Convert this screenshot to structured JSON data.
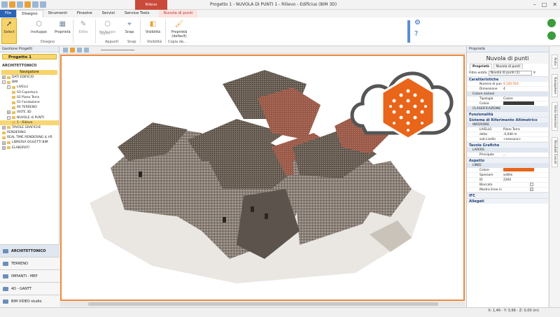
{
  "titlebar": {
    "title": "Progetto 1 - NUVOLA DI PUNTI 1 - Rilievo - Edificius (BIM 3D)",
    "context_header": "Rilievo"
  },
  "tabs": [
    {
      "label": "File"
    },
    {
      "label": "Disegno"
    },
    {
      "label": "Strumenti"
    },
    {
      "label": "Finestre"
    },
    {
      "label": "Servizi"
    },
    {
      "label": "Service Tools"
    },
    {
      "label": "Nuvola di punti"
    }
  ],
  "ribbon": {
    "select": "Select",
    "inviluppo": "Inviluppo",
    "proprieta": "Proprietà",
    "edita": "Edita",
    "inviluppo2": "Inviluppo",
    "taglia": "Taglia",
    "snap": "Snap",
    "visibilita": "Visibilità",
    "proprieta_default": "Proprietà (default)",
    "groups": {
      "disegno": "Disegno",
      "appunti": "Appunti",
      "snap": "Snap",
      "visibilita": "Visibilità",
      "copia": "Copia de..."
    }
  },
  "leftpanel": {
    "header": "Gestione Progetti",
    "project_tab": "Progetto 1",
    "section": "ARCHITETTONICO",
    "navigator": "Navigatore",
    "tree": [
      {
        "label": "DATI EDIFICIO",
        "indent": 0,
        "box": "+"
      },
      {
        "label": "BIM",
        "indent": 0,
        "box": "-"
      },
      {
        "label": "LIVELLI",
        "indent": 1,
        "box": "-"
      },
      {
        "label": "03 Copertura",
        "indent": 2,
        "box": ""
      },
      {
        "label": "02 Piano Terra",
        "indent": 2,
        "box": ""
      },
      {
        "label": "01 Fondazione",
        "indent": 2,
        "box": ""
      },
      {
        "label": "00 TERRENO",
        "indent": 2,
        "box": ""
      },
      {
        "label": "VISTE 3D",
        "indent": 1,
        "box": "+"
      },
      {
        "label": "NUVOLE di PUNTI",
        "indent": 1,
        "box": "-"
      },
      {
        "label": "1 - Rilievo",
        "indent": 2,
        "box": "",
        "selected": true
      },
      {
        "label": "TAVOLE GRAFICHE",
        "indent": 0,
        "box": "+"
      },
      {
        "label": "RENDERING",
        "indent": 0,
        "box": ""
      },
      {
        "label": "REAL TIME RENDERING & VR",
        "indent": 0,
        "box": ""
      },
      {
        "label": "LIBRERIA OGGETTI BIM",
        "indent": 0,
        "box": "+"
      },
      {
        "label": "ELABORATI",
        "indent": 0,
        "box": "+"
      }
    ],
    "modules": [
      {
        "label": "ARCHITETTONICO",
        "active": true
      },
      {
        "label": "TERRENO"
      },
      {
        "label": "IMPIANTI - MEP"
      },
      {
        "label": "4D - GANTT"
      },
      {
        "label": "BIM VIDEO studio"
      }
    ]
  },
  "statusbar": {
    "coords": "X: 1,46 - Y: 3,66 - Z: 0,00 (m)"
  },
  "properties": {
    "header": "Proprietà",
    "title": "Nuvola di punti",
    "tabs": [
      "Proprietà",
      "Nuvola di punti"
    ],
    "filter_label": "Filtro entità",
    "filter_value": "Nuvola di punti (1)",
    "caratteristiche": "Caratteristiche",
    "rows_a": [
      {
        "k": "Numero di punti",
        "v": "8.185.564",
        "accent": true
      },
      {
        "k": "Dimensione",
        "v": "4"
      }
    ],
    "colore_sezioni": "Colore sezioni",
    "rows_b": [
      {
        "k": "Tipologia",
        "v": "Colore"
      },
      {
        "k": "Colore",
        "v": ""
      }
    ],
    "classificazione": "CLASSIFICAZIONE",
    "funzionalita": "Funzionalità",
    "sistema": "Sistema di Riferimento Altimetrico",
    "inferiore": "INFERIORE",
    "rows_c": [
      {
        "k": "LIVELLO",
        "v": "Piano Terra"
      },
      {
        "k": "delta",
        "v": "-0,040 m"
      },
      {
        "k": "sub Livello",
        "v": "<nessuno>"
      }
    ],
    "tavole": "Tavole Grafiche",
    "layers": "LAYERS",
    "rows_d": [
      {
        "k": "Principale",
        "v": "..."
      }
    ],
    "aspetto": "Aspetto",
    "linee": "LINEE",
    "rows_e": [
      {
        "k": "Colore",
        "v": ""
      },
      {
        "k": "Spessore",
        "v": "sottile"
      }
    ],
    "rows_f": [
      {
        "k": "ID",
        "v": "2264"
      },
      {
        "k": "Bloccato",
        "v": ""
      },
      {
        "k": "Mostra linee in 3D",
        "v": "✓"
      }
    ],
    "ifc": "IFC",
    "allegati": "Allegati",
    "accent_color": "#e8651a",
    "dark_color": "#3a3a3a"
  },
  "sidestrip": [
    "Aiuto",
    "Navigatore",
    "Vista Selezioni",
    "Risultati Calcoli"
  ]
}
